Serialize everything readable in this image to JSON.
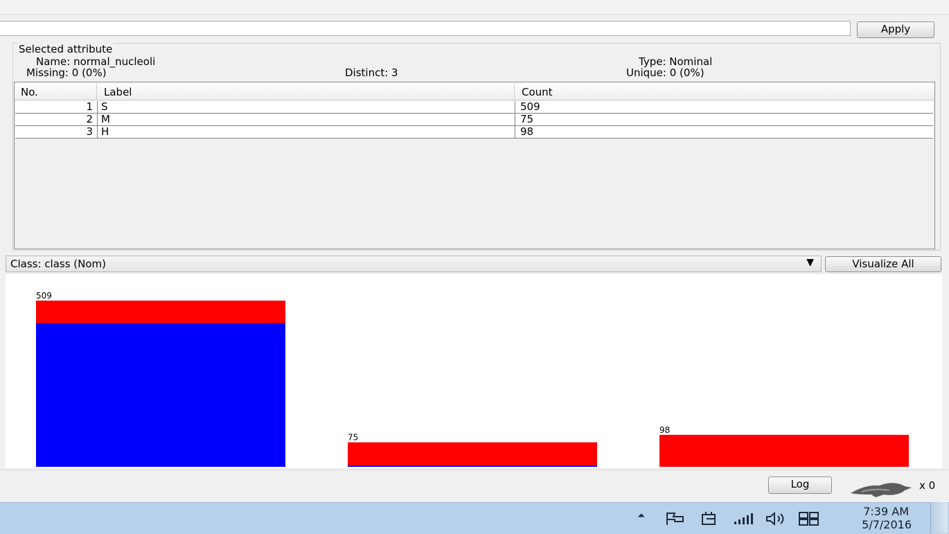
{
  "toolbar": {
    "apply_label": "Apply"
  },
  "attribute": {
    "section_title": "Selected attribute",
    "name": "Name: normal_nucleoli",
    "missing": "Missing: 0 (0%)",
    "distinct": "Distinct: 3",
    "type": "Type: Nominal",
    "unique": "Unique: 0 (0%)"
  },
  "table": {
    "headers": [
      "No.",
      "Label",
      "Count"
    ],
    "rows": [
      {
        "no": "1",
        "label": "S",
        "count": "509"
      },
      {
        "no": "2",
        "label": "M",
        "count": "75"
      },
      {
        "no": "3",
        "label": "H",
        "count": "98"
      }
    ]
  },
  "class_selector": {
    "value": "Class: class (Nom)"
  },
  "visualize_all_label": "Visualize All",
  "chart_data": {
    "type": "bar",
    "stacked": true,
    "categories": [
      "S",
      "M",
      "H"
    ],
    "bar_labels": [
      "509",
      "75",
      "98"
    ],
    "series": [
      {
        "color": "#0000ff",
        "values": [
          440,
          4,
          0
        ]
      },
      {
        "color": "#ff0000",
        "values": [
          69,
          71,
          98
        ]
      }
    ]
  },
  "status": {
    "log_label": "Log",
    "task_count": "x 0",
    "bird_icon": "weka-bird-icon"
  },
  "taskbar": {
    "time": "7:39 AM",
    "date": "5/7/2016",
    "icons": [
      "show-hidden-icons",
      "action-center-flag-icon",
      "power-icon",
      "network-signal-icon",
      "volume-icon",
      "windows-icon"
    ]
  }
}
